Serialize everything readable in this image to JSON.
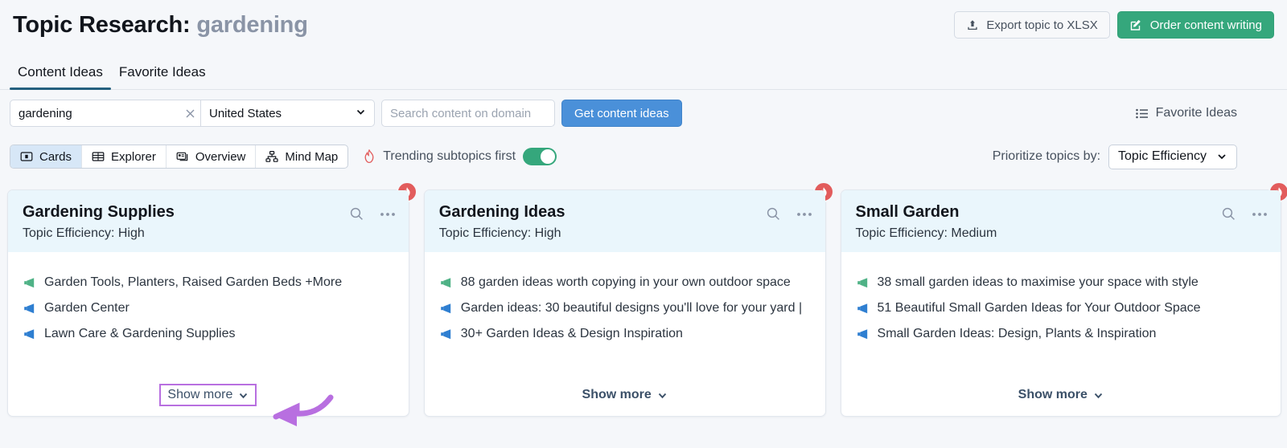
{
  "header": {
    "title_prefix": "Topic Research:",
    "keyword": "gardening",
    "export_label": "Export topic to XLSX",
    "export_icon": "upload-icon",
    "order_label": "Order content writing",
    "order_icon": "edit-square-icon",
    "order_color": "#35a77c"
  },
  "tabs": [
    {
      "label": "Content Ideas",
      "active": true
    },
    {
      "label": "Favorite Ideas",
      "active": false
    }
  ],
  "search": {
    "keyword_value": "gardening",
    "clear_icon": "close-icon",
    "country_value": "United States",
    "country_chevron": "chevron-down-icon",
    "domain_placeholder": "Search content on domain",
    "submit_label": "Get content ideas",
    "submit_color": "#4a90d9",
    "favorite_ideas_label": "Favorite Ideas",
    "favorite_ideas_icon": "list-icon"
  },
  "view_modes": [
    {
      "label": "Cards",
      "icon": "cards-icon",
      "active": true
    },
    {
      "label": "Explorer",
      "icon": "table-icon",
      "active": false
    },
    {
      "label": "Overview",
      "icon": "overview-icon",
      "active": false
    },
    {
      "label": "Mind Map",
      "icon": "mindmap-icon",
      "active": false
    }
  ],
  "trending": {
    "label": "Trending subtopics first",
    "icon": "flame-icon",
    "enabled": true,
    "toggle_color": "#35a77c"
  },
  "prioritize": {
    "label": "Prioritize topics by:",
    "value": "Topic Efficiency",
    "chevron": "chevron-down-icon"
  },
  "cards": [
    {
      "title": "Gardening Supplies",
      "efficiency": "Topic Efficiency: High",
      "trending": true,
      "search_icon": "search-icon",
      "menu_icon": "ellipsis-icon",
      "ideas": [
        {
          "text": "Garden Tools, Planters, Raised Garden Beds +More",
          "icon": "megaphone-icon",
          "color": "#4fb286"
        },
        {
          "text": "Garden Center",
          "icon": "megaphone-icon",
          "color": "#2f7fd1"
        },
        {
          "text": "Lawn Care & Gardening Supplies",
          "icon": "megaphone-icon",
          "color": "#2f7fd1"
        }
      ],
      "show_more": "Show more",
      "show_more_highlighted": true
    },
    {
      "title": "Gardening Ideas",
      "efficiency": "Topic Efficiency: High",
      "trending": true,
      "search_icon": "search-icon",
      "menu_icon": "ellipsis-icon",
      "ideas": [
        {
          "text": "88 garden ideas worth copying in your own outdoor space",
          "icon": "megaphone-icon",
          "color": "#4fb286"
        },
        {
          "text": "Garden ideas: 30 beautiful designs you'll love for your yard |",
          "icon": "megaphone-icon",
          "color": "#2f7fd1"
        },
        {
          "text": "30+ Garden Ideas & Design Inspiration",
          "icon": "megaphone-icon",
          "color": "#2f7fd1"
        }
      ],
      "show_more": "Show more",
      "show_more_highlighted": false
    },
    {
      "title": "Small Garden",
      "efficiency": "Topic Efficiency: Medium",
      "trending": true,
      "search_icon": "search-icon",
      "menu_icon": "ellipsis-icon",
      "ideas": [
        {
          "text": "38 small garden ideas to maximise your space with style",
          "icon": "megaphone-icon",
          "color": "#4fb286"
        },
        {
          "text": "51 Beautiful Small Garden Ideas for Your Outdoor Space",
          "icon": "megaphone-icon",
          "color": "#2f7fd1"
        },
        {
          "text": "Small Garden Ideas: Design, Plants & Inspiration",
          "icon": "megaphone-icon",
          "color": "#2f7fd1"
        }
      ],
      "show_more": "Show more",
      "show_more_highlighted": false
    }
  ],
  "annotation": {
    "color": "#b86fe0",
    "shape": "curved-arrow-pointing-left"
  }
}
